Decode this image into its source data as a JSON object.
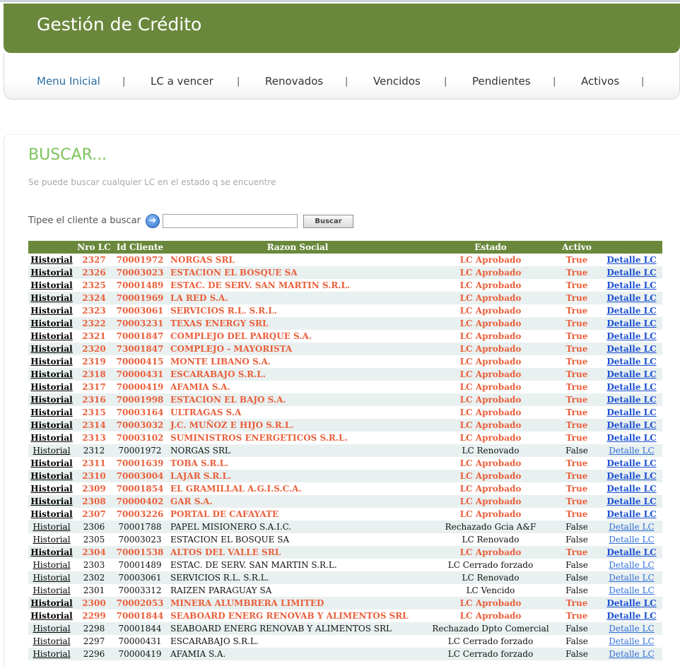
{
  "app_title": "Gestión de Crédito",
  "nav": [
    {
      "label": "Menu Inicial",
      "active": true
    },
    {
      "label": "LC a vencer",
      "active": false
    },
    {
      "label": "Renovados",
      "active": false
    },
    {
      "label": "Vencidos",
      "active": false
    },
    {
      "label": "Pendientes",
      "active": false
    },
    {
      "label": "Activos",
      "active": false
    }
  ],
  "nav_separator": "|",
  "search": {
    "title": "BUSCAR...",
    "subtitle": "Se puede buscar cualquier LC en el estado q se encuentre",
    "label": "Tipee el cliente a buscar",
    "input_value": "",
    "button_label": "Buscar",
    "icon": "arrow-right-circle-icon"
  },
  "table": {
    "headers": [
      "",
      "Nro LC",
      "Id Cliente",
      "Razon Social",
      "Estado",
      "Activo",
      ""
    ],
    "history_label": "Historial",
    "detail_label": "Detalle LC",
    "rows": [
      {
        "nro": "2327",
        "cliente": "70001972",
        "razon": "NORGAS SRL",
        "estado": "LC Aprobado",
        "activo": "True"
      },
      {
        "nro": "2326",
        "cliente": "70003023",
        "razon": "ESTACION EL BOSQUE SA",
        "estado": "LC Aprobado",
        "activo": "True"
      },
      {
        "nro": "2325",
        "cliente": "70001489",
        "razon": "ESTAC. DE SERV. SAN MARTIN S.R.L.",
        "estado": "LC Aprobado",
        "activo": "True"
      },
      {
        "nro": "2324",
        "cliente": "70001969",
        "razon": "LA RED S.A.",
        "estado": "LC Aprobado",
        "activo": "True"
      },
      {
        "nro": "2323",
        "cliente": "70003061",
        "razon": "SERVICIOS R.L. S.R.L.",
        "estado": "LC Aprobado",
        "activo": "True"
      },
      {
        "nro": "2322",
        "cliente": "70003231",
        "razon": "TEXAS ENERGY SRL",
        "estado": "LC Aprobado",
        "activo": "True"
      },
      {
        "nro": "2321",
        "cliente": "70001847",
        "razon": "COMPLEJO DEL PARQUE S.A.",
        "estado": "LC Aprobado",
        "activo": "True"
      },
      {
        "nro": "2320",
        "cliente": "73001847",
        "razon": "COMPLEJO - MAYORISTA",
        "estado": "LC Aprobado",
        "activo": "True"
      },
      {
        "nro": "2319",
        "cliente": "70000415",
        "razon": "MONTE LIBANO S.A.",
        "estado": "LC Aprobado",
        "activo": "True"
      },
      {
        "nro": "2318",
        "cliente": "70000431",
        "razon": "ESCARABAJO S.R.L.",
        "estado": "LC Aprobado",
        "activo": "True"
      },
      {
        "nro": "2317",
        "cliente": "70000419",
        "razon": "AFAMIA S.A.",
        "estado": "LC Aprobado",
        "activo": "True"
      },
      {
        "nro": "2316",
        "cliente": "70001998",
        "razon": "ESTACION EL BAJO S.A.",
        "estado": "LC Aprobado",
        "activo": "True"
      },
      {
        "nro": "2315",
        "cliente": "70003164",
        "razon": "ULTRAGAS S.A",
        "estado": "LC Aprobado",
        "activo": "True"
      },
      {
        "nro": "2314",
        "cliente": "70003032",
        "razon": "J.C. MUÑOZ E HIJO S.R.L.",
        "estado": "LC Aprobado",
        "activo": "True"
      },
      {
        "nro": "2313",
        "cliente": "70003102",
        "razon": "SUMINISTROS ENERGETICOS S.R.L.",
        "estado": "LC Aprobado",
        "activo": "True"
      },
      {
        "nro": "2312",
        "cliente": "70001972",
        "razon": "NORGAS SRL",
        "estado": "LC Renovado",
        "activo": "False"
      },
      {
        "nro": "2311",
        "cliente": "70001639",
        "razon": "TOBA S.R.L.",
        "estado": "LC Aprobado",
        "activo": "True"
      },
      {
        "nro": "2310",
        "cliente": "70003004",
        "razon": "LAJAR S.R.L.",
        "estado": "LC Aprobado",
        "activo": "True"
      },
      {
        "nro": "2309",
        "cliente": "70001854",
        "razon": "EL GRAMILLAL A.G.I.S.C.A.",
        "estado": "LC Aprobado",
        "activo": "True"
      },
      {
        "nro": "2308",
        "cliente": "70000402",
        "razon": "GAR S.A.",
        "estado": "LC Aprobado",
        "activo": "True"
      },
      {
        "nro": "2307",
        "cliente": "70003226",
        "razon": "PORTAL DE CAFAYATE",
        "estado": "LC Aprobado",
        "activo": "True"
      },
      {
        "nro": "2306",
        "cliente": "70001788",
        "razon": "PAPEL MISIONERO S.A.I.C.",
        "estado": "Rechazado Gcia A&F",
        "activo": "False"
      },
      {
        "nro": "2305",
        "cliente": "70003023",
        "razon": "ESTACION EL BOSQUE SA",
        "estado": "LC Renovado",
        "activo": "False"
      },
      {
        "nro": "2304",
        "cliente": "70001538",
        "razon": "ALTOS DEL VALLE SRL",
        "estado": "LC Aprobado",
        "activo": "True"
      },
      {
        "nro": "2303",
        "cliente": "70001489",
        "razon": "ESTAC. DE SERV. SAN MARTIN S.R.L.",
        "estado": "LC Cerrado forzado",
        "activo": "False"
      },
      {
        "nro": "2302",
        "cliente": "70003061",
        "razon": "SERVICIOS R.L. S.R.L.",
        "estado": "LC Renovado",
        "activo": "False"
      },
      {
        "nro": "2301",
        "cliente": "70003312",
        "razon": "RAIZEN PARAGUAY SA",
        "estado": "LC Vencido",
        "activo": "False"
      },
      {
        "nro": "2300",
        "cliente": "70002053",
        "razon": "MINERA ALUMBRERA LIMITED",
        "estado": "LC Aprobado",
        "activo": "True"
      },
      {
        "nro": "2299",
        "cliente": "70001844",
        "razon": "SEABOARD ENERG RENOVAB Y ALIMENTOS SRL",
        "estado": "LC Aprobado",
        "activo": "True"
      },
      {
        "nro": "2298",
        "cliente": "70001844",
        "razon": "SEABOARD ENERG RENOVAB Y ALIMENTOS SRL",
        "estado": "Rechazado Dpto Comercial",
        "activo": "False"
      },
      {
        "nro": "2297",
        "cliente": "70000431",
        "razon": "ESCARABAJO S.R.L.",
        "estado": "LC Cerrado forzado",
        "activo": "False"
      },
      {
        "nro": "2296",
        "cliente": "70000419",
        "razon": "AFAMIA S.A.",
        "estado": "LC Cerrado forzado",
        "activo": "False"
      }
    ]
  },
  "colors": {
    "brand_green": "#6a883c",
    "highlight_orange": "#e8603c",
    "link_blue": "#1a4fd1",
    "title_green": "#7cc35a"
  }
}
